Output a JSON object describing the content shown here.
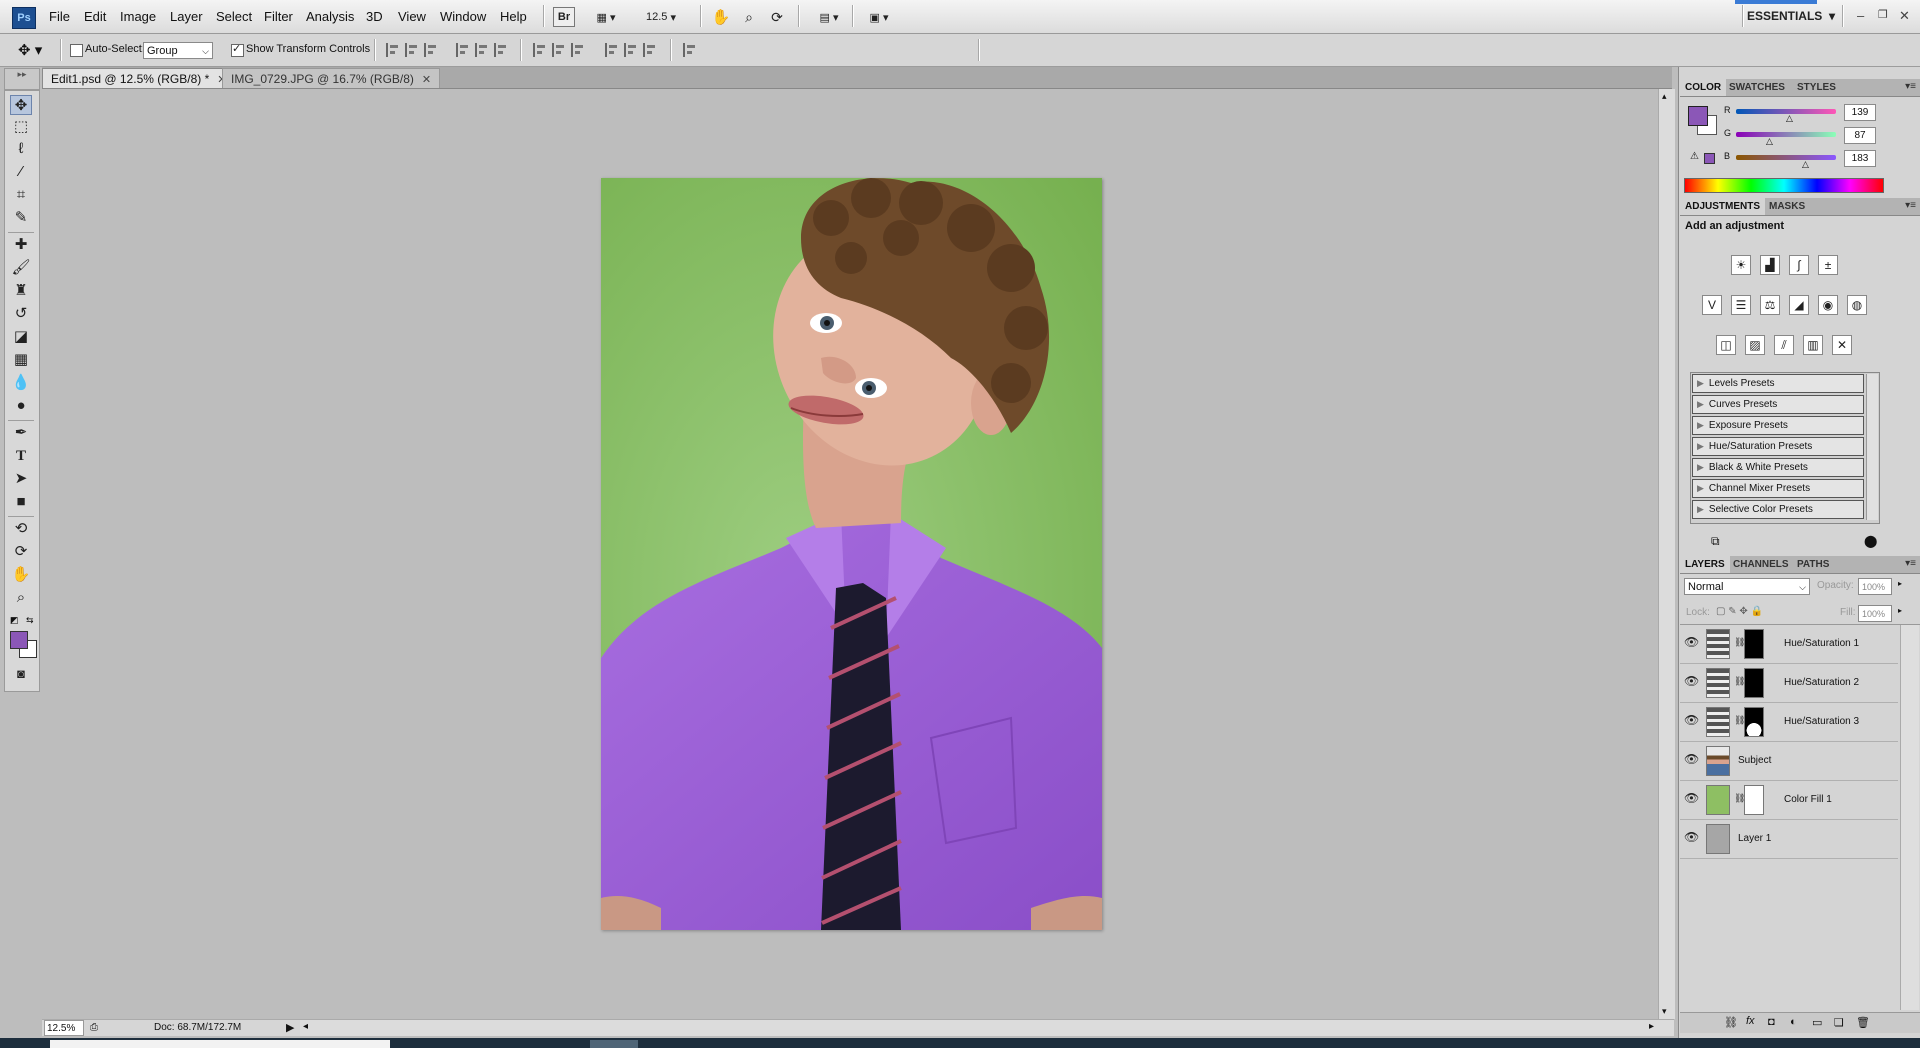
{
  "app": {
    "logo": "Ps"
  },
  "menu": [
    "File",
    "Edit",
    "Image",
    "Layer",
    "Select",
    "Filter",
    "Analysis",
    "3D",
    "View",
    "Window",
    "Help"
  ],
  "menubar_right": {
    "bridge_label": "Br",
    "zoom_value": "12.5",
    "workspace": "ESSENTIALS"
  },
  "options": {
    "auto_select_label": "Auto-Select:",
    "auto_select_checked": false,
    "auto_select_value": "Group",
    "show_transform_label": "Show Transform Controls",
    "show_transform_checked": true
  },
  "tabs": [
    {
      "label": "Edit1.psd @ 12.5% (RGB/8) *",
      "active": true
    },
    {
      "label": "IMG_0729.JPG @ 16.7% (RGB/8)",
      "active": false
    }
  ],
  "status": {
    "zoom": "12.5%",
    "doc": "Doc: 68.7M/172.7M"
  },
  "color_panel": {
    "tabs": [
      "COLOR",
      "SWATCHES",
      "STYLES"
    ],
    "r": "139",
    "g": "87",
    "b": "183",
    "r_label": "R",
    "g_label": "G",
    "b_label": "B",
    "foreground": "#8b57b7"
  },
  "adjustments": {
    "tabs": [
      "ADJUSTMENTS",
      "MASKS"
    ],
    "heading": "Add an adjustment",
    "presets": [
      "Levels Presets",
      "Curves Presets",
      "Exposure Presets",
      "Hue/Saturation Presets",
      "Black & White Presets",
      "Channel Mixer Presets",
      "Selective Color Presets"
    ]
  },
  "layers_panel": {
    "tabs": [
      "LAYERS",
      "CHANNELS",
      "PATHS"
    ],
    "blend_mode": "Normal",
    "opacity_label": "Opacity:",
    "opacity": "100%",
    "lock_label": "Lock:",
    "fill_label": "Fill:",
    "fill": "100%",
    "layers": [
      {
        "name": "Hue/Saturation 1",
        "type": "adjustment"
      },
      {
        "name": "Hue/Saturation 2",
        "type": "adjustment"
      },
      {
        "name": "Hue/Saturation 3",
        "type": "adjustment"
      },
      {
        "name": "Subject",
        "type": "image"
      },
      {
        "name": "Color Fill 1",
        "type": "fill"
      },
      {
        "name": "Layer 1",
        "type": "plain"
      }
    ]
  },
  "colors": {
    "accent": "#8b57b7",
    "green_bg": "#8ebf63",
    "shirt": "#9a60d6"
  }
}
